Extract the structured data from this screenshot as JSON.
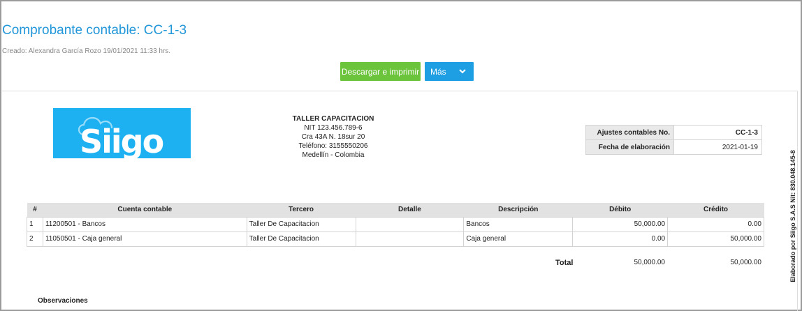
{
  "header": {
    "title": "Comprobante contable: CC-1-3",
    "created": "Creado: Alexandra García Rozo 19/01/2021 11:33 hrs."
  },
  "actions": {
    "download_label": "Descargar e imprimir",
    "more_label": "Más"
  },
  "logo": {
    "text": "Siigo",
    "color": "#1eb1f2"
  },
  "company": {
    "name": "TALLER CAPACITACION",
    "nit": "NIT 123.456.789-6",
    "address": "Cra 43A N. 18sur 20",
    "phone": "Teléfono: 3155550206",
    "city": "Medellín - Colombia"
  },
  "meta": {
    "doc_label": "Ajustes contables No.",
    "doc_value": "CC-1-3",
    "date_label": "Fecha de elaboración",
    "date_value": "2021-01-19"
  },
  "side_note": "Elaborado por Siigo S.A.S Nit: 830.048.145-8",
  "table": {
    "headers": [
      "#",
      "Cuenta contable",
      "Tercero",
      "Detalle",
      "Descripción",
      "Débito",
      "Crédito"
    ],
    "rows": [
      [
        "1",
        "11200501 - Bancos",
        "Taller De Capacitacion",
        "",
        "Bancos",
        "50,000.00",
        "0.00"
      ],
      [
        "2",
        "11050501 - Caja general",
        "Taller De Capacitacion",
        "",
        "Caja general",
        "0.00",
        "50,000.00"
      ]
    ]
  },
  "totals": {
    "label": "Total",
    "debit": "50,000.00",
    "credit": "50,000.00"
  },
  "observations_label": "Observaciones",
  "colors": {
    "title": "#2196d8",
    "download_button": "#6cc33c",
    "more_button": "#1e9ee3"
  }
}
